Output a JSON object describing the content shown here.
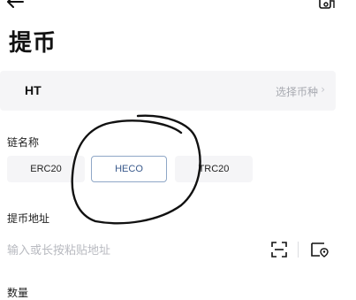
{
  "header": {
    "title": "提币"
  },
  "coin": {
    "name": "HT",
    "select_label": "选择币种",
    "chevron": "›"
  },
  "chain": {
    "label": "链名称",
    "options": [
      {
        "label": "ERC20",
        "active": false
      },
      {
        "label": "HECO",
        "active": true
      },
      {
        "label": "TRC20",
        "active": false
      }
    ]
  },
  "address": {
    "label": "提币地址",
    "placeholder": "输入或长按粘贴地址",
    "value": ""
  },
  "amount": {
    "label": "数量"
  },
  "icons": [
    "back-arrow-icon",
    "record-icon",
    "scan-icon",
    "address-book-icon"
  ],
  "colors": {
    "accent": "#3a5a8c",
    "placeholder": "#b8bac0",
    "panel": "#f5f5f7"
  }
}
